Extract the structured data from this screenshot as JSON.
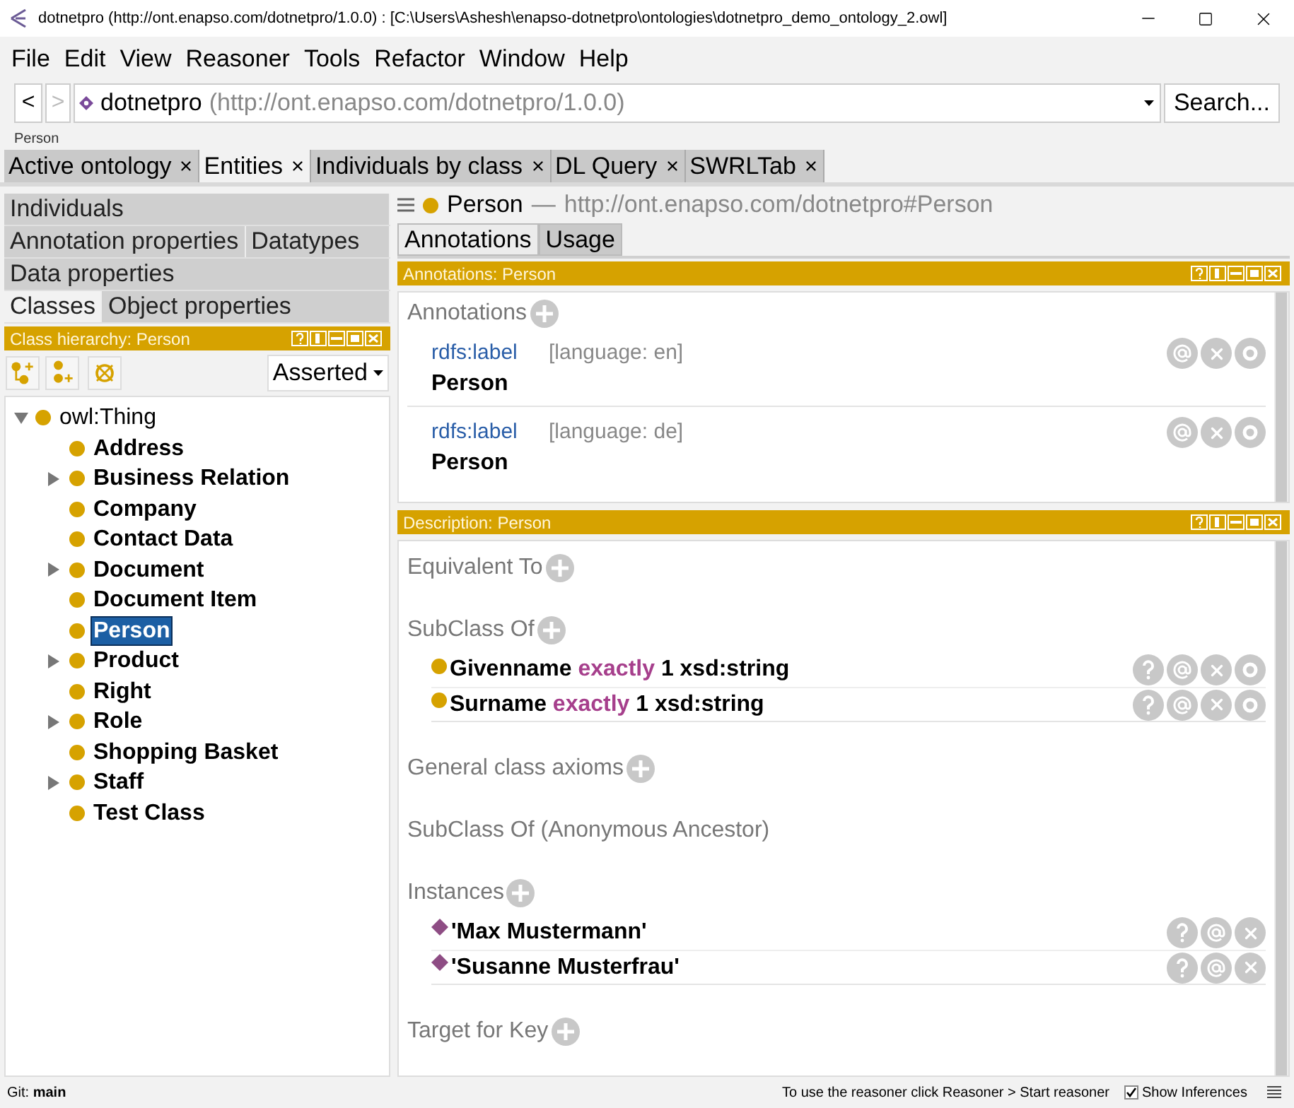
{
  "window": {
    "title": "dotnetpro (http://ont.enapso.com/dotnetpro/1.0.0)  : [C:\\Users\\Ashesh\\enapso-dotnetpro\\ontologies\\dotnetpro_demo_ontology_2.owl]"
  },
  "menu": [
    "File",
    "Edit",
    "View",
    "Reasoner",
    "Tools",
    "Refactor",
    "Window",
    "Help"
  ],
  "nav": {
    "back": "<",
    "forward": ">",
    "ontology": "dotnetpro",
    "iri": "(http://ont.enapso.com/dotnetpro/1.0.0)",
    "search": "Search..."
  },
  "breadcrumb": "Person",
  "tabs": [
    {
      "label": "Active ontology",
      "selected": false
    },
    {
      "label": "Entities",
      "selected": true
    },
    {
      "label": "Individuals by class",
      "selected": false
    },
    {
      "label": "DL Query",
      "selected": false
    },
    {
      "label": "SWRLTab",
      "selected": false
    }
  ],
  "entity_tabs": [
    [
      {
        "label": "Individuals",
        "selected": false
      }
    ],
    [
      {
        "label": "Annotation properties",
        "selected": false
      },
      {
        "label": "Datatypes",
        "selected": false
      }
    ],
    [
      {
        "label": "Data properties",
        "selected": false
      }
    ],
    [
      {
        "label": "Classes",
        "selected": true
      },
      {
        "label": "Object properties",
        "selected": false
      }
    ]
  ],
  "class_hierarchy": {
    "title": "Class hierarchy: Person",
    "mode": "Asserted",
    "tree": [
      {
        "label": "owl:Thing",
        "expanded": true,
        "selected": false,
        "children": [
          {
            "label": "Address",
            "expandable": false,
            "selected": false
          },
          {
            "label": "Business Relation",
            "expandable": true,
            "selected": false
          },
          {
            "label": "Company",
            "expandable": false,
            "selected": false
          },
          {
            "label": "Contact Data",
            "expandable": false,
            "selected": false
          },
          {
            "label": "Document",
            "expandable": true,
            "selected": false
          },
          {
            "label": "Document Item",
            "expandable": false,
            "selected": false
          },
          {
            "label": "Person",
            "expandable": false,
            "selected": true
          },
          {
            "label": "Product",
            "expandable": true,
            "selected": false
          },
          {
            "label": "Right",
            "expandable": false,
            "selected": false
          },
          {
            "label": "Role",
            "expandable": true,
            "selected": false
          },
          {
            "label": "Shopping Basket",
            "expandable": false,
            "selected": false
          },
          {
            "label": "Staff",
            "expandable": true,
            "selected": false
          },
          {
            "label": "Test Class",
            "expandable": false,
            "selected": false
          }
        ]
      }
    ]
  },
  "entity": {
    "name": "Person",
    "dash": "—",
    "iri": "http://ont.enapso.com/dotnetpro#Person"
  },
  "view_tabs": [
    {
      "label": "Annotations",
      "selected": true
    },
    {
      "label": "Usage",
      "selected": false
    }
  ],
  "annotations_panel": {
    "title": "Annotations: Person",
    "heading": "Annotations",
    "items": [
      {
        "property": "rdfs:label",
        "language": "[language: en]",
        "value": "Person"
      },
      {
        "property": "rdfs:label",
        "language": "[language: de]",
        "value": "Person"
      }
    ]
  },
  "description_panel": {
    "title": "Description: Person",
    "sections": [
      {
        "heading": "Equivalent To",
        "addable": true
      },
      {
        "heading": "SubClass Of",
        "addable": true,
        "items": [
          {
            "kind": "restriction",
            "name": "Givenname",
            "keyword": "exactly",
            "rest": "1 xsd:string"
          },
          {
            "kind": "restriction",
            "name": "Surname",
            "keyword": "exactly",
            "rest": "1 xsd:string"
          }
        ]
      },
      {
        "heading": "General class axioms",
        "addable": true
      },
      {
        "heading": "SubClass Of (Anonymous Ancestor)",
        "addable": false
      },
      {
        "heading": "Instances",
        "addable": true,
        "items": [
          {
            "kind": "individual",
            "name": "'Max Mustermann'"
          },
          {
            "kind": "individual",
            "name": "'Susanne Musterfrau'"
          }
        ]
      },
      {
        "heading": "Target for Key",
        "addable": true
      }
    ]
  },
  "status_bar": {
    "git_label": "Git:",
    "branch": "main",
    "message": "To use the reasoner click Reasoner > Start reasoner",
    "show_inferences": {
      "label": "Show Inferences",
      "checked": true
    }
  }
}
